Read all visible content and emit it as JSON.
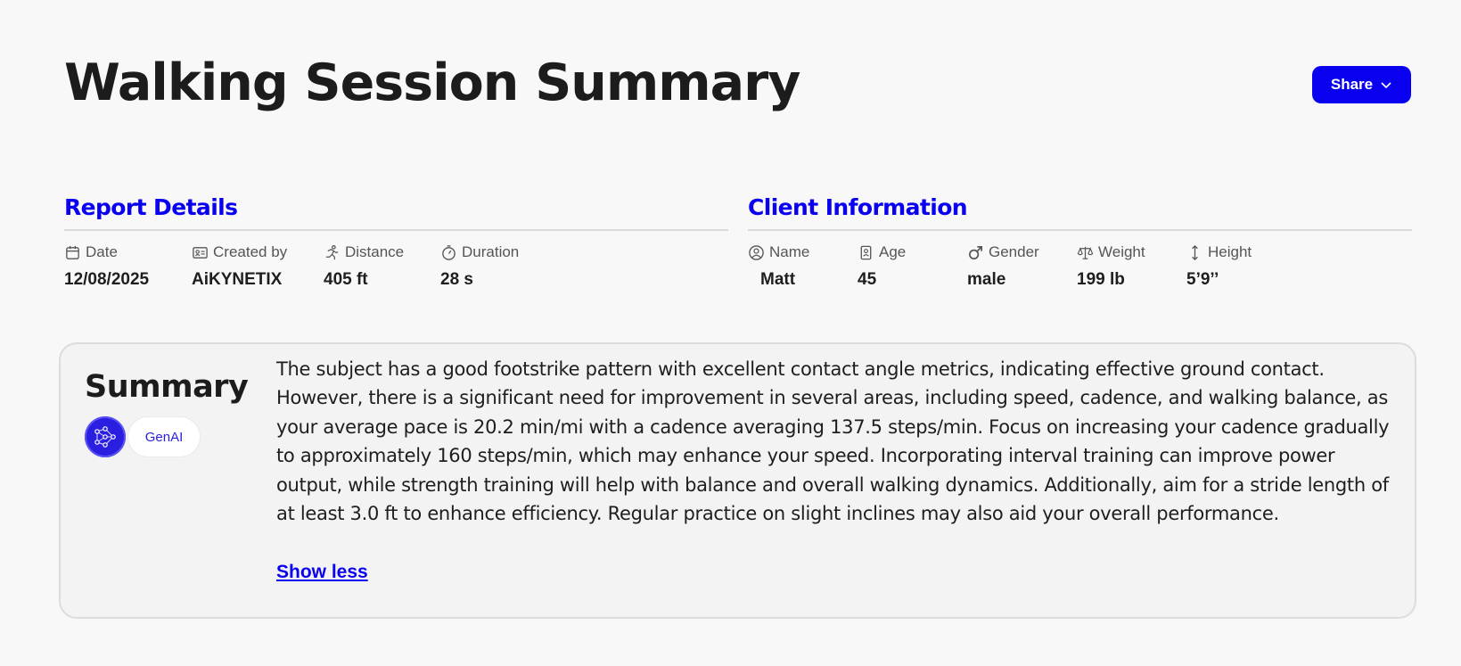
{
  "page": {
    "title": "Walking Session Summary"
  },
  "share_button": {
    "label": "Share"
  },
  "report_details": {
    "title": "Report Details",
    "fields": [
      {
        "label": "Date",
        "value": "12/08/2025",
        "icon": "calendar-icon"
      },
      {
        "label": "Created by",
        "value": "AiKYNETIX",
        "icon": "id-card-icon"
      },
      {
        "label": "Distance",
        "value": "405 ft",
        "icon": "runner-icon"
      },
      {
        "label": "Duration",
        "value": "28 s",
        "icon": "stopwatch-icon"
      }
    ]
  },
  "client_information": {
    "title": "Client Information",
    "fields": [
      {
        "label": "Name",
        "value": "Matt",
        "icon": "user-circle-icon"
      },
      {
        "label": "Age",
        "value": "45",
        "icon": "badge-icon"
      },
      {
        "label": "Gender",
        "value": "male",
        "icon": "male-symbol-icon"
      },
      {
        "label": "Weight",
        "value": "199 lb",
        "icon": "scale-icon"
      },
      {
        "label": "Height",
        "value": "5’9’’",
        "icon": "vertical-arrows-icon"
      }
    ]
  },
  "summary": {
    "title": "Summary",
    "badge": "GenAI",
    "text": "The subject has a good footstrike pattern with excellent contact angle metrics, indicating effective ground contact. However, there is a significant need for improvement in several areas, including speed, cadence, and walking balance, as your average pace is 20.2 min/mi with a cadence averaging 137.5 steps/min. Focus on increasing your cadence gradually to approximately 160 steps/min, which may enhance your speed. Incorporating interval training can improve power output, while strength training will help with balance and overall walking dynamics. Additionally, aim for a stride length of at least 3.0 ft to enhance efficiency. Regular practice on slight inclines may also aid your overall performance.",
    "show_less": "Show less"
  },
  "colors": {
    "accent": "#0a00f0",
    "background": "#f8f8f8"
  }
}
